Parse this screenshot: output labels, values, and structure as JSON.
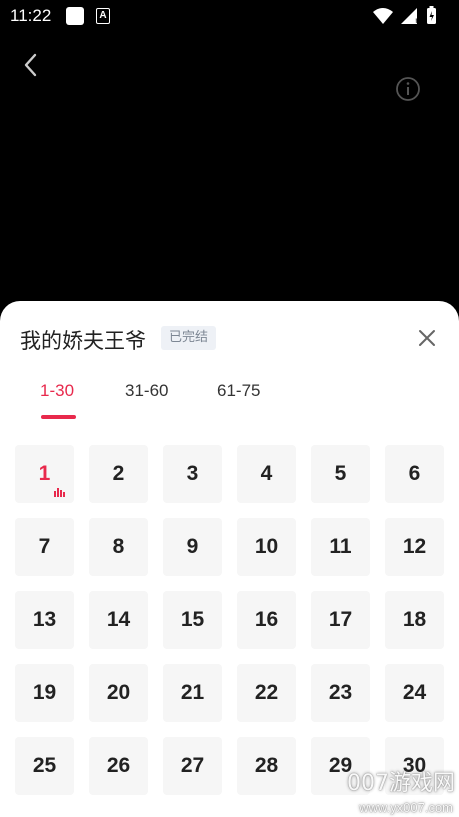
{
  "status_bar": {
    "time": "11:22",
    "app_icon_letter": "A"
  },
  "sheet": {
    "title": "我的娇夫王爷",
    "status_badge": "已完结",
    "tabs": [
      {
        "label": "1-30",
        "active": true
      },
      {
        "label": "31-60",
        "active": false
      },
      {
        "label": "61-75",
        "active": false
      }
    ],
    "episodes": [
      "1",
      "2",
      "3",
      "4",
      "5",
      "6",
      "7",
      "8",
      "9",
      "10",
      "11",
      "12",
      "13",
      "14",
      "15",
      "16",
      "17",
      "18",
      "19",
      "20",
      "21",
      "22",
      "23",
      "24",
      "25",
      "26",
      "27",
      "28",
      "29",
      "30"
    ],
    "current_episode": "1"
  },
  "watermark": {
    "text": "007游戏网",
    "url": "www.yx007.com"
  },
  "colors": {
    "accent": "#e8294c",
    "cell_bg": "#f6f6f6",
    "badge_bg": "#eef1f6"
  },
  "icons": [
    "back-arrow-icon",
    "info-icon",
    "close-icon",
    "playing-bars-icon",
    "wifi-icon",
    "signal-icon",
    "battery-icon"
  ]
}
